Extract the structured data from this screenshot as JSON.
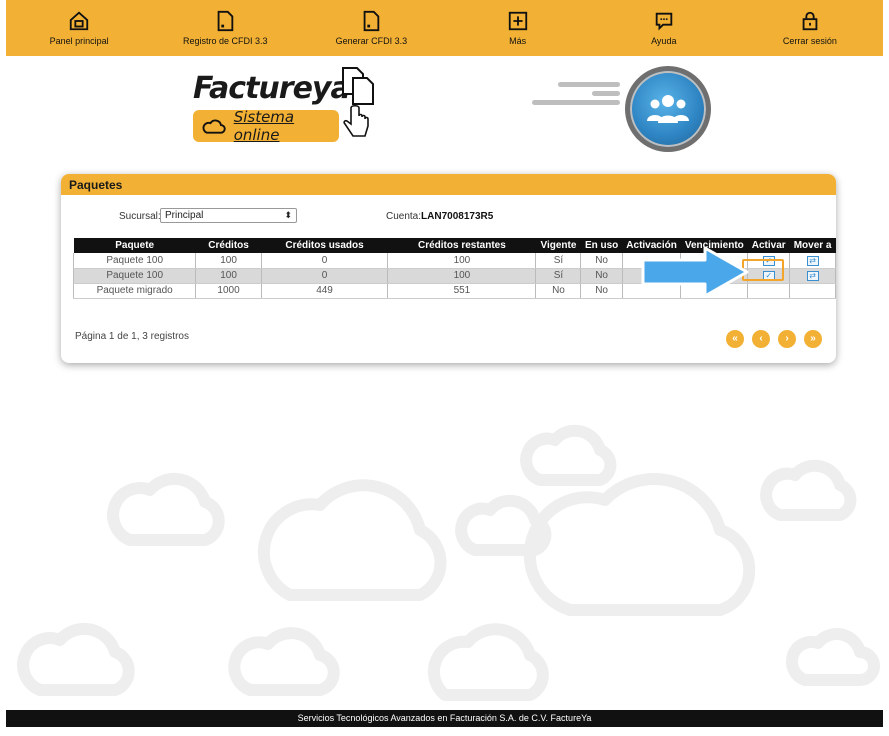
{
  "nav": [
    {
      "label": "Panel principal",
      "icon": "home-icon"
    },
    {
      "label": "Registro de CFDI 3.3",
      "icon": "document-icon"
    },
    {
      "label": "Generar CFDI 3.3",
      "icon": "document-icon"
    },
    {
      "label": "Más",
      "icon": "plus-icon"
    },
    {
      "label": "Ayuda",
      "icon": "chat-icon"
    },
    {
      "label": "Cerrar sesión",
      "icon": "lock-icon"
    }
  ],
  "brand": {
    "name": "Factureya",
    "tagline": "Sistema online"
  },
  "panel": {
    "title": "Paquetes",
    "sucursal_label": "Sucursal:",
    "sucursal_value": "Principal",
    "cuenta_label": "Cuenta:",
    "cuenta_value": "LAN7008173R5"
  },
  "table": {
    "headers": [
      "Paquete",
      "Créditos",
      "Créditos usados",
      "Créditos restantes",
      "Vigente",
      "En uso",
      "Activación",
      "Vencimiento",
      "Activar",
      "Mover a"
    ],
    "rows": [
      {
        "paquete": "Paquete 100",
        "creditos": "100",
        "usados": "0",
        "restantes": "100",
        "vigente": "Sí",
        "en_uso": "No",
        "activacion": "",
        "vencimiento": "",
        "activar": true,
        "mover": true
      },
      {
        "paquete": "Paquete 100",
        "creditos": "100",
        "usados": "0",
        "restantes": "100",
        "vigente": "Sí",
        "en_uso": "No",
        "activacion": "",
        "vencimiento": "",
        "activar": true,
        "mover": true
      },
      {
        "paquete": "Paquete migrado",
        "creditos": "1000",
        "usados": "449",
        "restantes": "551",
        "vigente": "No",
        "en_uso": "No",
        "activacion": "",
        "vencimiento": "",
        "activar": false,
        "mover": false
      }
    ]
  },
  "pager": {
    "summary": "Página 1 de 1, 3 registros",
    "first": "«",
    "prev": "‹",
    "next": "›",
    "last": "»"
  },
  "footer": "Servicios Tecnológicos Avanzados en Facturación S.A. de C.V. FactureYa",
  "colors": {
    "accent": "#f2b134",
    "header_bg": "#111111",
    "icon_blue": "#3a8fd0"
  }
}
